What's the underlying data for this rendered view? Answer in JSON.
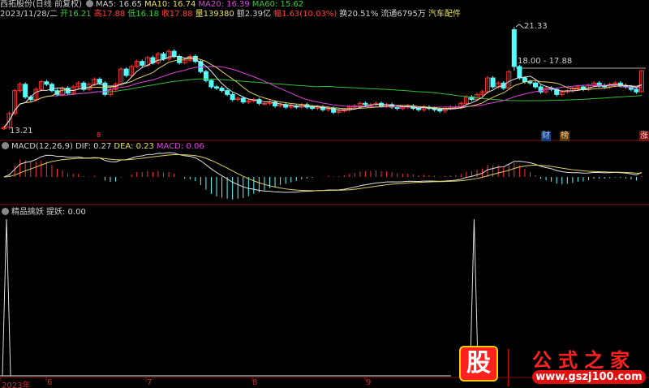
{
  "header": {
    "stock_name": "西拓股份(日线 前复权)",
    "ma5": "MA5: 16.65",
    "ma10": "MA10: 16.74",
    "ma20": "MA20: 16.39",
    "ma60": "MA60: 15.62",
    "date": "2023/11/28/二",
    "open": "开16.21",
    "high": "高17.88",
    "low": "低16.18",
    "close": "收17.88",
    "volume": "量139380",
    "amount": "额2.39亿",
    "change": "幅1.63(10.03%)",
    "turnover": "换20.51%",
    "float": "流通6795万",
    "sector": "汽车配件"
  },
  "macd_header": {
    "name": "MACD(12,26,9)",
    "dif": "DIF: 0.27",
    "dea": "DEA: 0.23",
    "macd": "MACD: 0.06"
  },
  "ind_header": {
    "name": "精品擒妖",
    "value": "提妖: 0.00"
  },
  "annotations": {
    "high_label": "21.33",
    "range_label": "18.00 - 17.88",
    "low_label": "13.21",
    "tag_cai": "财",
    "tag_bang": "榜",
    "tag_zhang": "涨",
    "marker_8": "8"
  },
  "xaxis": {
    "labels": [
      "2023年",
      "6",
      "7",
      "8",
      "9"
    ]
  },
  "logo": {
    "badge": "股",
    "title": "公式之家",
    "url": "www.gszj100.com"
  },
  "colors": {
    "up": "#ff3232",
    "down": "#54ffff",
    "ma5": "#e0e0e0",
    "ma10": "#e0d060",
    "ma20": "#e040e0",
    "ma60": "#30c030"
  },
  "chart_data": {
    "type": "candlestick",
    "y_range": [
      13.21,
      21.33
    ],
    "closes": [
      13.4,
      14.5,
      16.3,
      16.8,
      15.8,
      15.6,
      16.4,
      17.0,
      16.8,
      16.3,
      16.0,
      16.5,
      16.1,
      16.6,
      16.9,
      16.4,
      16.8,
      17.2,
      16.9,
      16.0,
      16.4,
      16.8,
      18.0,
      17.5,
      18.2,
      18.6,
      18.3,
      18.9,
      18.5,
      19.2,
      18.8,
      19.4,
      19.0,
      18.5,
      18.7,
      19.0,
      18.6,
      17.8,
      17.1,
      16.6,
      16.5,
      16.3,
      16.0,
      15.6,
      15.7,
      15.4,
      15.5,
      15.6,
      15.3,
      15.3,
      15.4,
      15.1,
      15.2,
      15.0,
      15.1,
      15.0,
      15.2,
      15.0,
      14.9,
      15.0,
      14.8,
      14.9,
      14.6,
      14.7,
      14.8,
      15.0,
      15.1,
      15.3,
      15.2,
      15.2,
      15.3,
      15.1,
      15.2,
      15.0,
      14.9,
      15.0,
      15.1,
      14.9,
      14.8,
      15.0,
      14.9,
      14.8,
      14.7,
      14.9,
      15.0,
      15.0,
      15.3,
      15.8,
      15.6,
      16.0,
      16.2,
      17.3,
      16.6,
      16.9,
      16.5,
      17.8,
      18.2,
      17.3,
      17.0,
      16.9,
      16.6,
      16.2,
      16.5,
      16.4,
      16.0,
      16.2,
      16.3,
      16.5,
      16.6,
      16.4,
      16.7,
      16.9,
      16.7,
      16.6,
      16.8,
      16.9,
      16.7,
      16.6,
      16.4,
      16.2,
      17.88
    ],
    "special": {
      "96": {
        "open": 21.1,
        "high": 21.33,
        "low": 17.88
      },
      "120": {
        "open": 16.21,
        "high": 17.88,
        "low": 16.18
      },
      "0": {
        "low": 13.21
      }
    },
    "indicator_spikes": [
      0,
      88
    ],
    "indicator_peak": 1
  }
}
